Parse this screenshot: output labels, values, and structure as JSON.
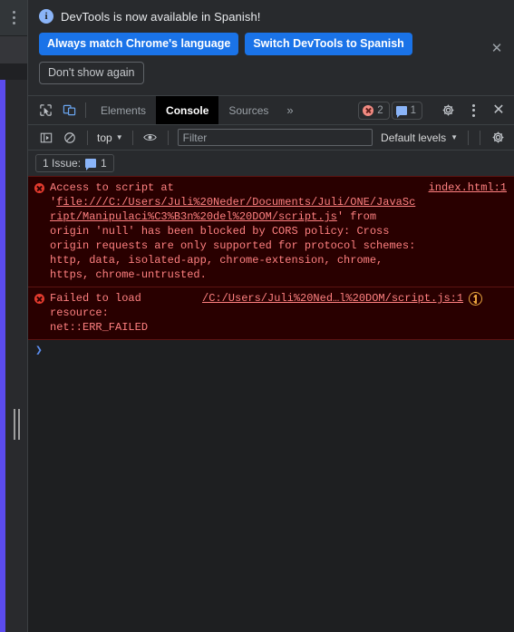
{
  "browser_edge": {
    "menu_icon": "three-dots-vertical-icon",
    "accent_color": "#5b4bed",
    "resize_handle": "drag-handle"
  },
  "banner": {
    "info_icon": "info-icon",
    "message": "DevTools is now available in Spanish!",
    "primary_buttons": [
      {
        "label": "Always match Chrome's language",
        "name": "always-match-language-button"
      },
      {
        "label": "Switch DevTools to Spanish",
        "name": "switch-devtools-language-button"
      }
    ],
    "dismiss_label": "Don't show again",
    "close_icon": "close-icon",
    "accent_color": "#1a73e8"
  },
  "tabbar": {
    "inspect_icon": "inspect-element-icon",
    "device_toggle_icon": "device-toolbar-icon",
    "tabs": [
      {
        "label": "Elements",
        "active": false
      },
      {
        "label": "Console",
        "active": true
      },
      {
        "label": "Sources",
        "active": false
      }
    ],
    "more_tabs_icon": "chevron-double-right-icon",
    "error_count": "2",
    "message_count": "1",
    "settings_icon": "gear-icon",
    "more_options_icon": "three-dots-vertical-icon",
    "close_icon": "close-devtools-icon"
  },
  "filterbar": {
    "sidebar_toggle_icon": "console-sidebar-icon",
    "clear_console_icon": "clear-console-icon",
    "context": "top",
    "context_caret": "▼",
    "eye_icon": "live-expression-icon",
    "filter_placeholder": "Filter",
    "filter_value": "",
    "levels_label": "Default levels",
    "levels_caret": "▼",
    "settings_icon": "console-settings-gear-icon"
  },
  "issues": {
    "label": "1 Issue:",
    "icon": "message-bubble-icon",
    "count": "1"
  },
  "console": {
    "messages": [
      {
        "name": "console-error-cors",
        "icon": "error-circle-icon",
        "text_parts": [
          {
            "t": "Access to script at '",
            "link": false
          },
          {
            "t": "file:///C:/Users/Juli%20Neder/Documents/Juli/ONE/JavaScript/Manipulaci%C3%B3n%20del%20DOM/script.js",
            "link": true
          },
          {
            "t": "' from origin 'null' has been blocked by CORS policy: Cross origin requests are only supported for protocol schemes: http, data, isolated-app, chrome-extension, chrome, https, chrome-untrusted.",
            "link": false
          }
        ],
        "source": "index.html:1"
      },
      {
        "name": "console-error-failed-resource",
        "icon": "error-circle-icon",
        "text_parts": [
          {
            "t": "Failed to load resource: net::ERR_FAILED",
            "link": false
          }
        ],
        "source": "/C:/Users/Juli%20Ned…l%20DOM/script.js:1",
        "net_icon": "network-request-icon"
      }
    ],
    "prompt_chevron": "❯",
    "prompt_value": ""
  }
}
